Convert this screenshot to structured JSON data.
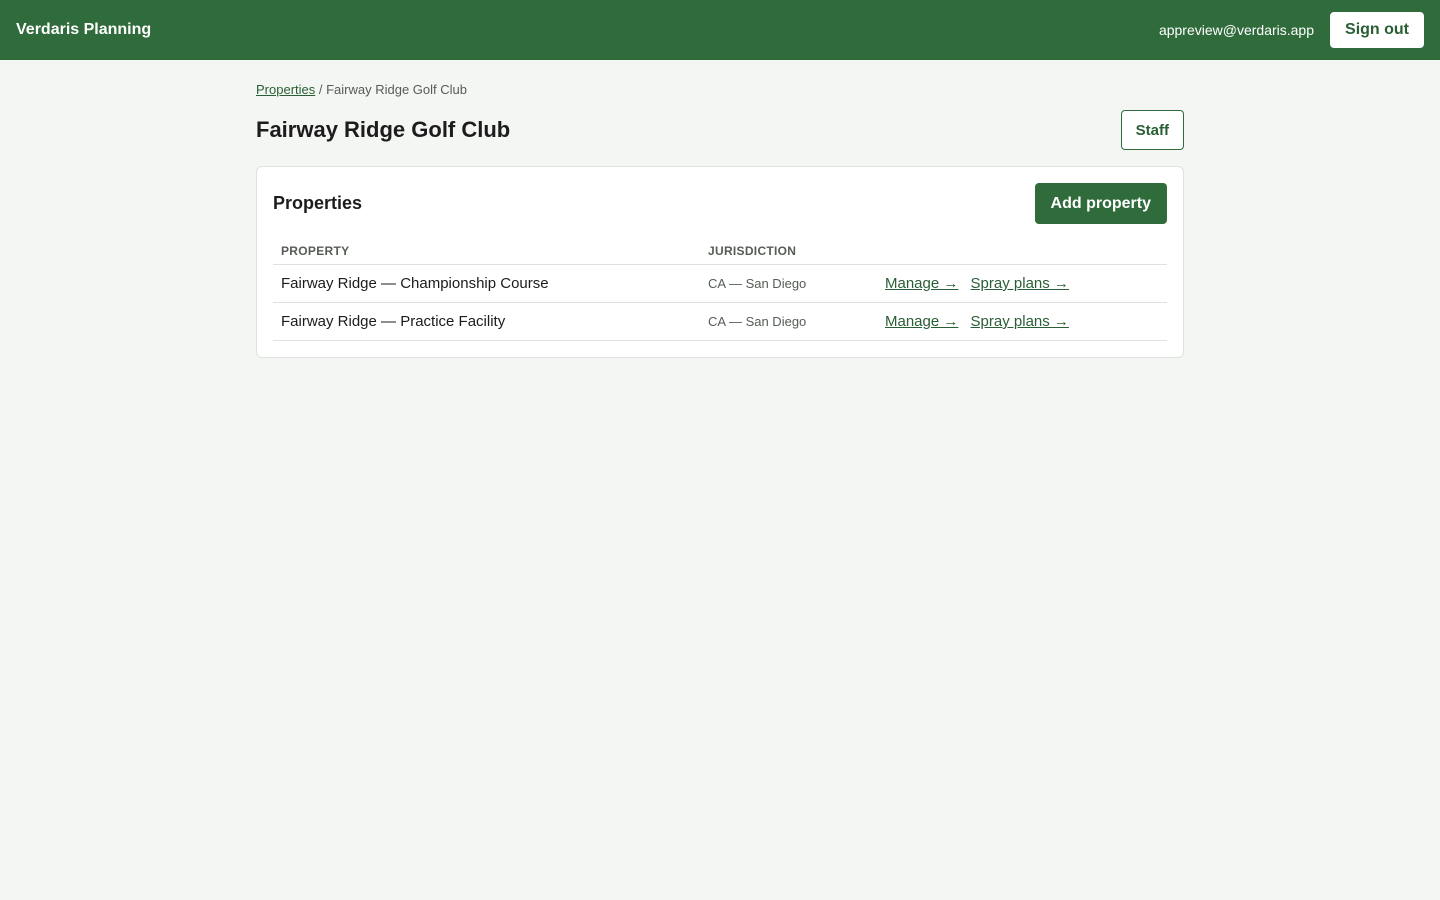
{
  "header": {
    "brand": "Verdaris Planning",
    "user_email": "appreview@verdaris.app",
    "signout_label": "Sign out"
  },
  "breadcrumb": {
    "root": "Properties",
    "separator": " / ",
    "current": "Fairway Ridge Golf Club"
  },
  "page": {
    "title": "Fairway Ridge Golf Club",
    "staff_label": "Staff"
  },
  "properties_card": {
    "title": "Properties",
    "add_label": "Add property",
    "columns": [
      "Property",
      "Jurisdiction",
      ""
    ],
    "rows": [
      {
        "name": "Fairway Ridge — Championship Course",
        "jurisdiction": "CA — San Diego",
        "manage": "Manage →",
        "spray": "Spray plans →"
      },
      {
        "name": "Fairway Ridge — Practice Facility",
        "jurisdiction": "CA — San Diego",
        "manage": "Manage →",
        "spray": "Spray plans →"
      }
    ]
  },
  "colors": {
    "brand_green": "#2f6b3b",
    "link_green": "#2a5e34",
    "background": "#f4f6f3"
  }
}
